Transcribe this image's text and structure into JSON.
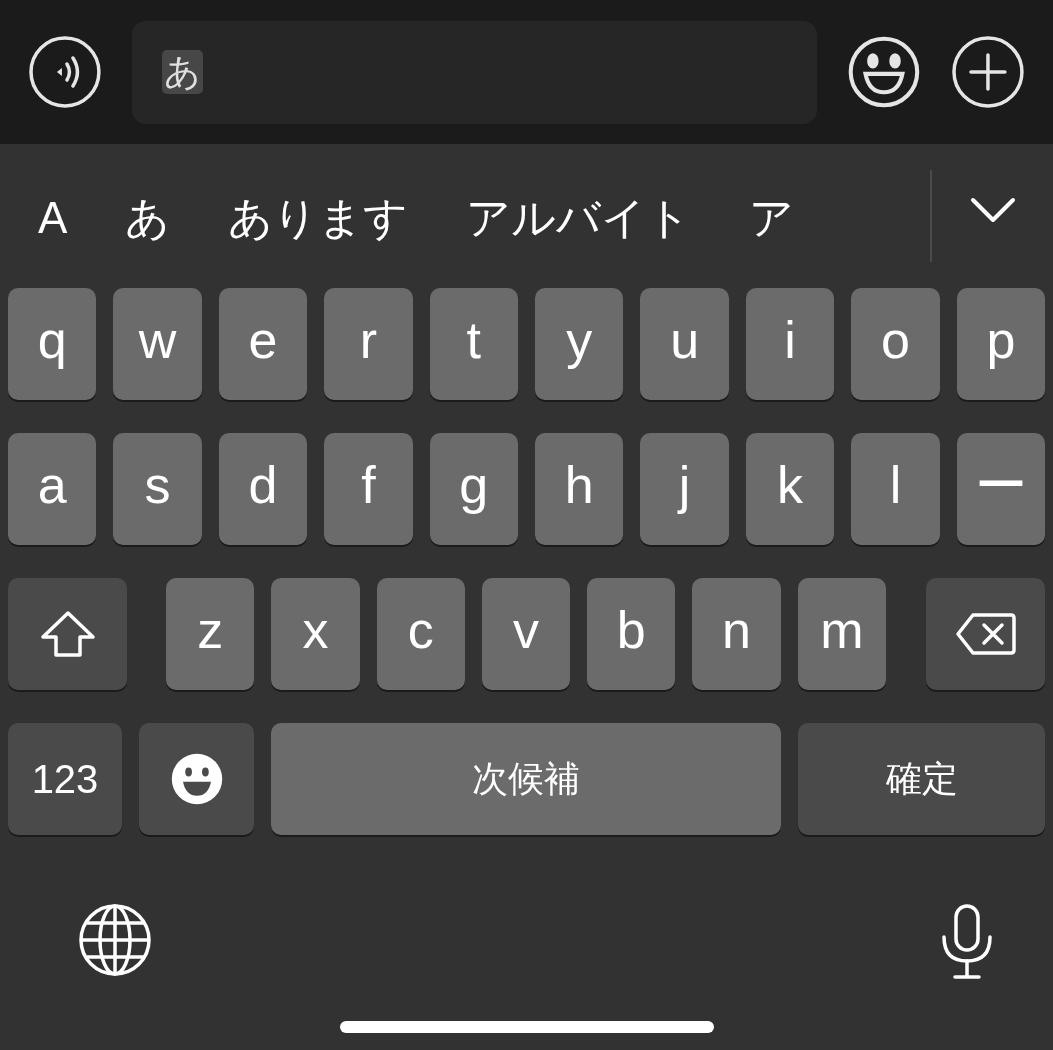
{
  "input_bar": {
    "text": "あ"
  },
  "candidates": [
    "A",
    "あ",
    "あります",
    "アルバイト",
    "ア"
  ],
  "key_rows": [
    [
      {
        "kind": "letter",
        "label": "q"
      },
      {
        "kind": "letter",
        "label": "w"
      },
      {
        "kind": "letter",
        "label": "e"
      },
      {
        "kind": "letter",
        "label": "r"
      },
      {
        "kind": "letter",
        "label": "t"
      },
      {
        "kind": "letter",
        "label": "y"
      },
      {
        "kind": "letter",
        "label": "u"
      },
      {
        "kind": "letter",
        "label": "i"
      },
      {
        "kind": "letter",
        "label": "o"
      },
      {
        "kind": "letter",
        "label": "p"
      }
    ],
    [
      {
        "kind": "letter",
        "label": "a"
      },
      {
        "kind": "letter",
        "label": "s"
      },
      {
        "kind": "letter",
        "label": "d"
      },
      {
        "kind": "letter",
        "label": "f"
      },
      {
        "kind": "letter",
        "label": "g"
      },
      {
        "kind": "letter",
        "label": "h"
      },
      {
        "kind": "letter",
        "label": "j"
      },
      {
        "kind": "letter",
        "label": "k"
      },
      {
        "kind": "letter",
        "label": "l"
      },
      {
        "kind": "letter",
        "label": "ー"
      }
    ],
    [
      {
        "kind": "shift"
      },
      {
        "kind": "letter",
        "label": "z"
      },
      {
        "kind": "letter",
        "label": "x"
      },
      {
        "kind": "letter",
        "label": "c"
      },
      {
        "kind": "letter",
        "label": "v"
      },
      {
        "kind": "letter",
        "label": "b"
      },
      {
        "kind": "letter",
        "label": "n"
      },
      {
        "kind": "letter",
        "label": "m"
      },
      {
        "kind": "delete"
      }
    ],
    [
      {
        "kind": "numbers",
        "label": "123"
      },
      {
        "kind": "emoji"
      },
      {
        "kind": "space",
        "label": "次候補"
      },
      {
        "kind": "confirm",
        "label": "確定"
      }
    ]
  ]
}
